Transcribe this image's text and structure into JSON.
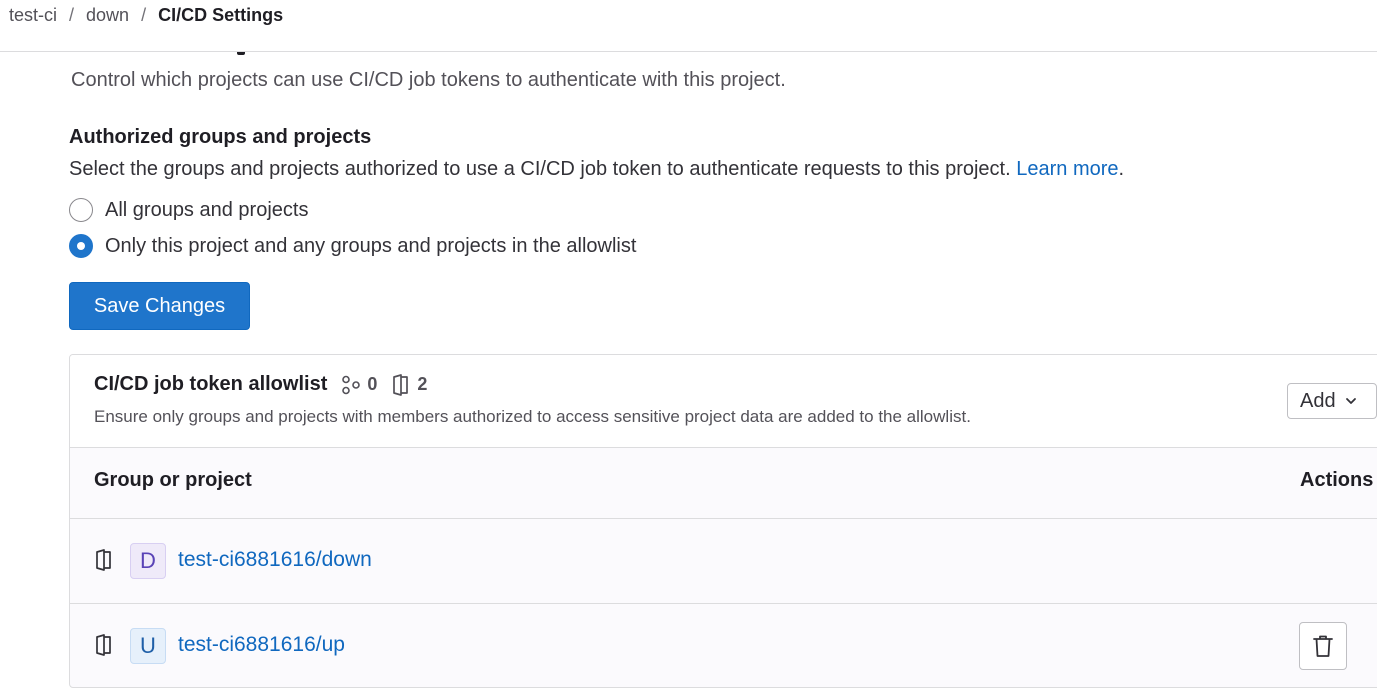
{
  "breadcrumb": {
    "items": [
      "test-ci",
      "down"
    ],
    "current": "CI/CD Settings",
    "separator": "/"
  },
  "section": {
    "description": "Control which projects can use CI/CD job tokens to authenticate with this project."
  },
  "authorized": {
    "title": "Authorized groups and projects",
    "description": "Select the groups and projects authorized to use a CI/CD job token to authenticate requests to this project.",
    "learn_more": "Learn more",
    "trailing": ".",
    "options": [
      {
        "label": "All groups and projects",
        "checked": false
      },
      {
        "label": "Only this project and any groups and projects in the allowlist",
        "checked": true
      }
    ],
    "save_label": "Save Changes"
  },
  "allowlist": {
    "title": "CI/CD job token allowlist",
    "group_count": "0",
    "project_count": "2",
    "description": "Ensure only groups and projects with members authorized to access sensitive project data are added to the allowlist.",
    "add_label": "Add",
    "columns": {
      "group_or_project": "Group or project",
      "actions": "Actions"
    },
    "rows": [
      {
        "avatar_letter": "D",
        "path": "test-ci6881616/down",
        "deletable": false
      },
      {
        "avatar_letter": "U",
        "path": "test-ci6881616/up",
        "deletable": true
      }
    ]
  },
  "colors": {
    "primary": "#1f75cb",
    "link": "#1068bf",
    "border": "#dcdcde"
  },
  "icons": [
    "group-icon",
    "project-icon",
    "chevron-down-icon",
    "trash-icon"
  ]
}
